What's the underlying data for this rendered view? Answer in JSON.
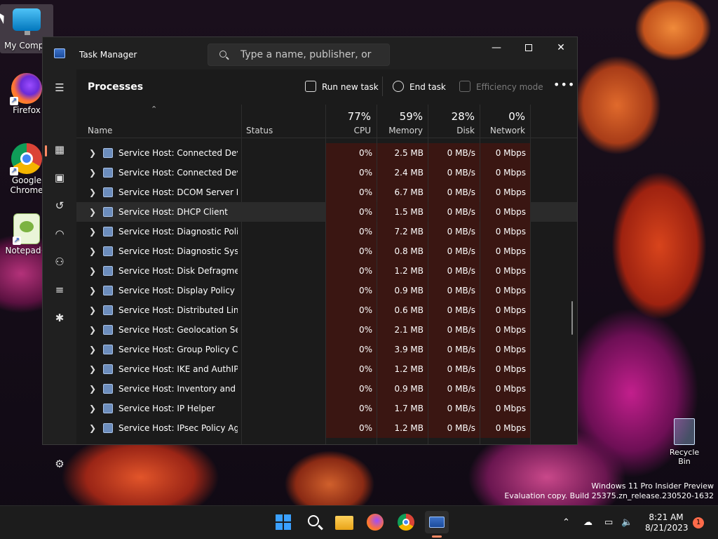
{
  "desktop": {
    "icons": [
      {
        "label": "My Compu"
      },
      {
        "label": "Firefox"
      },
      {
        "label": "Google Chrome"
      },
      {
        "label": "Notepad+"
      }
    ],
    "recycle_bin": "Recycle Bin",
    "watermark_line1": "Windows 11 Pro Insider Preview",
    "watermark_line2": "Evaluation copy. Build 25375.zn_release.230520-1632"
  },
  "window": {
    "title": "Task Manager",
    "search_placeholder": "Type a name, publisher, or PID...",
    "page_title": "Processes",
    "toolbar": {
      "run_new_task": "Run new task",
      "end_task": "End task",
      "efficiency_mode": "Efficiency mode"
    },
    "columns": {
      "name": "Name",
      "status": "Status",
      "cpu_pct": "77%",
      "cpu": "CPU",
      "memory_pct": "59%",
      "memory": "Memory",
      "disk_pct": "28%",
      "disk": "Disk",
      "network_pct": "0%",
      "network": "Network"
    },
    "rows": [
      {
        "name": "Service Host: Connected Devi...",
        "cpu": "0%",
        "memory": "2.5 MB",
        "disk": "0 MB/s",
        "network": "0 Mbps"
      },
      {
        "name": "Service Host: Connected Devi...",
        "cpu": "0%",
        "memory": "2.4 MB",
        "disk": "0 MB/s",
        "network": "0 Mbps"
      },
      {
        "name": "Service Host: DCOM Server Pr...",
        "cpu": "0%",
        "memory": "6.7 MB",
        "disk": "0 MB/s",
        "network": "0 Mbps"
      },
      {
        "name": "Service Host: DHCP Client",
        "cpu": "0%",
        "memory": "1.5 MB",
        "disk": "0 MB/s",
        "network": "0 Mbps"
      },
      {
        "name": "Service Host: Diagnostic Polic...",
        "cpu": "0%",
        "memory": "7.2 MB",
        "disk": "0 MB/s",
        "network": "0 Mbps"
      },
      {
        "name": "Service Host: Diagnostic Syste...",
        "cpu": "0%",
        "memory": "0.8 MB",
        "disk": "0 MB/s",
        "network": "0 Mbps"
      },
      {
        "name": "Service Host: Disk Defragmenter",
        "cpu": "0%",
        "memory": "1.2 MB",
        "disk": "0 MB/s",
        "network": "0 Mbps"
      },
      {
        "name": "Service Host: Display Policy Se...",
        "cpu": "0%",
        "memory": "0.9 MB",
        "disk": "0 MB/s",
        "network": "0 Mbps"
      },
      {
        "name": "Service Host: Distributed Link ...",
        "cpu": "0%",
        "memory": "0.6 MB",
        "disk": "0 MB/s",
        "network": "0 Mbps"
      },
      {
        "name": "Service Host: Geolocation Serv...",
        "cpu": "0%",
        "memory": "2.1 MB",
        "disk": "0 MB/s",
        "network": "0 Mbps"
      },
      {
        "name": "Service Host: Group Policy Cli...",
        "cpu": "0%",
        "memory": "3.9 MB",
        "disk": "0 MB/s",
        "network": "0 Mbps"
      },
      {
        "name": "Service Host: IKE and AuthIP I...",
        "cpu": "0%",
        "memory": "1.2 MB",
        "disk": "0 MB/s",
        "network": "0 Mbps"
      },
      {
        "name": "Service Host: Inventory and C...",
        "cpu": "0%",
        "memory": "0.9 MB",
        "disk": "0 MB/s",
        "network": "0 Mbps"
      },
      {
        "name": "Service Host: IP Helper",
        "cpu": "0%",
        "memory": "1.7 MB",
        "disk": "0 MB/s",
        "network": "0 Mbps"
      },
      {
        "name": "Service Host: IPsec Policy Agent",
        "cpu": "0%",
        "memory": "1.2 MB",
        "disk": "0 MB/s",
        "network": "0 Mbps"
      }
    ]
  },
  "taskbar": {
    "time": "8:21 AM",
    "date": "8/21/2023",
    "notification_count": "1"
  },
  "colors": {
    "accent": "#ff8a65",
    "heat_cell": "#3a1612",
    "window_bg": "#1f1f1f"
  }
}
